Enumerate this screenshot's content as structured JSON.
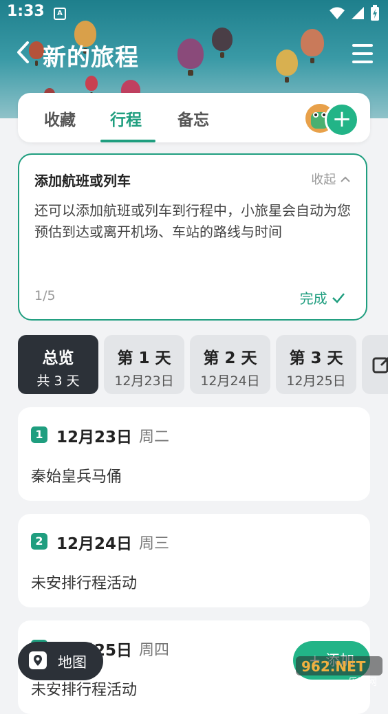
{
  "status_bar": {
    "time": "1:33",
    "badge": "A"
  },
  "header": {
    "title": "新的旅程"
  },
  "tabs": [
    {
      "label": "收藏"
    },
    {
      "label": "行程"
    },
    {
      "label": "备忘"
    }
  ],
  "tip": {
    "title": "添加航班或列车",
    "collapse_label": "收起",
    "body": "还可以添加航班或列车到行程中，小旅星会自动为您预估到达或离开机场、车站的路线与时间",
    "count": "1/5",
    "done_label": "完成"
  },
  "days": [
    {
      "label": "总览",
      "sub": "共 3 天"
    },
    {
      "label": "第 1 天",
      "sub": "12月23日"
    },
    {
      "label": "第 2 天",
      "sub": "12月24日"
    },
    {
      "label": "第 3 天",
      "sub": "12月25日"
    }
  ],
  "day_cards": [
    {
      "num": "1",
      "date": "12月23日",
      "weekday": "周二",
      "text": "秦始皇兵马俑"
    },
    {
      "num": "2",
      "date": "12月24日",
      "weekday": "周三",
      "text": "未安排行程活动"
    },
    {
      "num": "3",
      "date": "12月25日",
      "weekday": "周四",
      "text": "未安排行程活动"
    }
  ],
  "bottom": {
    "map_label": "地图",
    "add_label": "+ 添加"
  },
  "watermark": {
    "top": "962.NET",
    "bottom": "乐游网"
  },
  "colors": {
    "accent": "#1f9e7f",
    "dark": "#2c3138",
    "header": "#1e7f8c"
  }
}
